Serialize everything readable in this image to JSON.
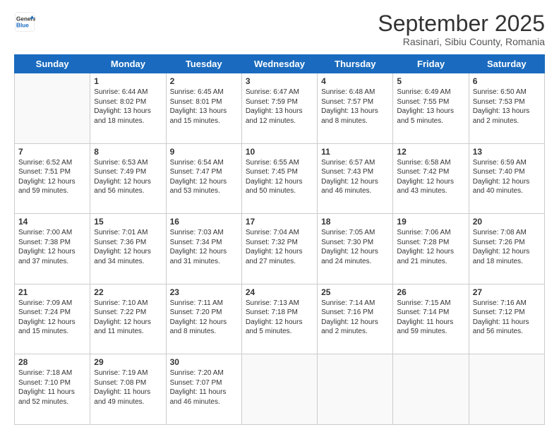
{
  "logo": {
    "line1": "General",
    "line2": "Blue"
  },
  "title": "September 2025",
  "location": "Rasinari, Sibiu County, Romania",
  "days_of_week": [
    "Sunday",
    "Monday",
    "Tuesday",
    "Wednesday",
    "Thursday",
    "Friday",
    "Saturday"
  ],
  "weeks": [
    [
      {
        "day": "",
        "info": ""
      },
      {
        "day": "1",
        "info": "Sunrise: 6:44 AM\nSunset: 8:02 PM\nDaylight: 13 hours\nand 18 minutes."
      },
      {
        "day": "2",
        "info": "Sunrise: 6:45 AM\nSunset: 8:01 PM\nDaylight: 13 hours\nand 15 minutes."
      },
      {
        "day": "3",
        "info": "Sunrise: 6:47 AM\nSunset: 7:59 PM\nDaylight: 13 hours\nand 12 minutes."
      },
      {
        "day": "4",
        "info": "Sunrise: 6:48 AM\nSunset: 7:57 PM\nDaylight: 13 hours\nand 8 minutes."
      },
      {
        "day": "5",
        "info": "Sunrise: 6:49 AM\nSunset: 7:55 PM\nDaylight: 13 hours\nand 5 minutes."
      },
      {
        "day": "6",
        "info": "Sunrise: 6:50 AM\nSunset: 7:53 PM\nDaylight: 13 hours\nand 2 minutes."
      }
    ],
    [
      {
        "day": "7",
        "info": "Sunrise: 6:52 AM\nSunset: 7:51 PM\nDaylight: 12 hours\nand 59 minutes."
      },
      {
        "day": "8",
        "info": "Sunrise: 6:53 AM\nSunset: 7:49 PM\nDaylight: 12 hours\nand 56 minutes."
      },
      {
        "day": "9",
        "info": "Sunrise: 6:54 AM\nSunset: 7:47 PM\nDaylight: 12 hours\nand 53 minutes."
      },
      {
        "day": "10",
        "info": "Sunrise: 6:55 AM\nSunset: 7:45 PM\nDaylight: 12 hours\nand 50 minutes."
      },
      {
        "day": "11",
        "info": "Sunrise: 6:57 AM\nSunset: 7:43 PM\nDaylight: 12 hours\nand 46 minutes."
      },
      {
        "day": "12",
        "info": "Sunrise: 6:58 AM\nSunset: 7:42 PM\nDaylight: 12 hours\nand 43 minutes."
      },
      {
        "day": "13",
        "info": "Sunrise: 6:59 AM\nSunset: 7:40 PM\nDaylight: 12 hours\nand 40 minutes."
      }
    ],
    [
      {
        "day": "14",
        "info": "Sunrise: 7:00 AM\nSunset: 7:38 PM\nDaylight: 12 hours\nand 37 minutes."
      },
      {
        "day": "15",
        "info": "Sunrise: 7:01 AM\nSunset: 7:36 PM\nDaylight: 12 hours\nand 34 minutes."
      },
      {
        "day": "16",
        "info": "Sunrise: 7:03 AM\nSunset: 7:34 PM\nDaylight: 12 hours\nand 31 minutes."
      },
      {
        "day": "17",
        "info": "Sunrise: 7:04 AM\nSunset: 7:32 PM\nDaylight: 12 hours\nand 27 minutes."
      },
      {
        "day": "18",
        "info": "Sunrise: 7:05 AM\nSunset: 7:30 PM\nDaylight: 12 hours\nand 24 minutes."
      },
      {
        "day": "19",
        "info": "Sunrise: 7:06 AM\nSunset: 7:28 PM\nDaylight: 12 hours\nand 21 minutes."
      },
      {
        "day": "20",
        "info": "Sunrise: 7:08 AM\nSunset: 7:26 PM\nDaylight: 12 hours\nand 18 minutes."
      }
    ],
    [
      {
        "day": "21",
        "info": "Sunrise: 7:09 AM\nSunset: 7:24 PM\nDaylight: 12 hours\nand 15 minutes."
      },
      {
        "day": "22",
        "info": "Sunrise: 7:10 AM\nSunset: 7:22 PM\nDaylight: 12 hours\nand 11 minutes."
      },
      {
        "day": "23",
        "info": "Sunrise: 7:11 AM\nSunset: 7:20 PM\nDaylight: 12 hours\nand 8 minutes."
      },
      {
        "day": "24",
        "info": "Sunrise: 7:13 AM\nSunset: 7:18 PM\nDaylight: 12 hours\nand 5 minutes."
      },
      {
        "day": "25",
        "info": "Sunrise: 7:14 AM\nSunset: 7:16 PM\nDaylight: 12 hours\nand 2 minutes."
      },
      {
        "day": "26",
        "info": "Sunrise: 7:15 AM\nSunset: 7:14 PM\nDaylight: 11 hours\nand 59 minutes."
      },
      {
        "day": "27",
        "info": "Sunrise: 7:16 AM\nSunset: 7:12 PM\nDaylight: 11 hours\nand 56 minutes."
      }
    ],
    [
      {
        "day": "28",
        "info": "Sunrise: 7:18 AM\nSunset: 7:10 PM\nDaylight: 11 hours\nand 52 minutes."
      },
      {
        "day": "29",
        "info": "Sunrise: 7:19 AM\nSunset: 7:08 PM\nDaylight: 11 hours\nand 49 minutes."
      },
      {
        "day": "30",
        "info": "Sunrise: 7:20 AM\nSunset: 7:07 PM\nDaylight: 11 hours\nand 46 minutes."
      },
      {
        "day": "",
        "info": ""
      },
      {
        "day": "",
        "info": ""
      },
      {
        "day": "",
        "info": ""
      },
      {
        "day": "",
        "info": ""
      }
    ]
  ]
}
